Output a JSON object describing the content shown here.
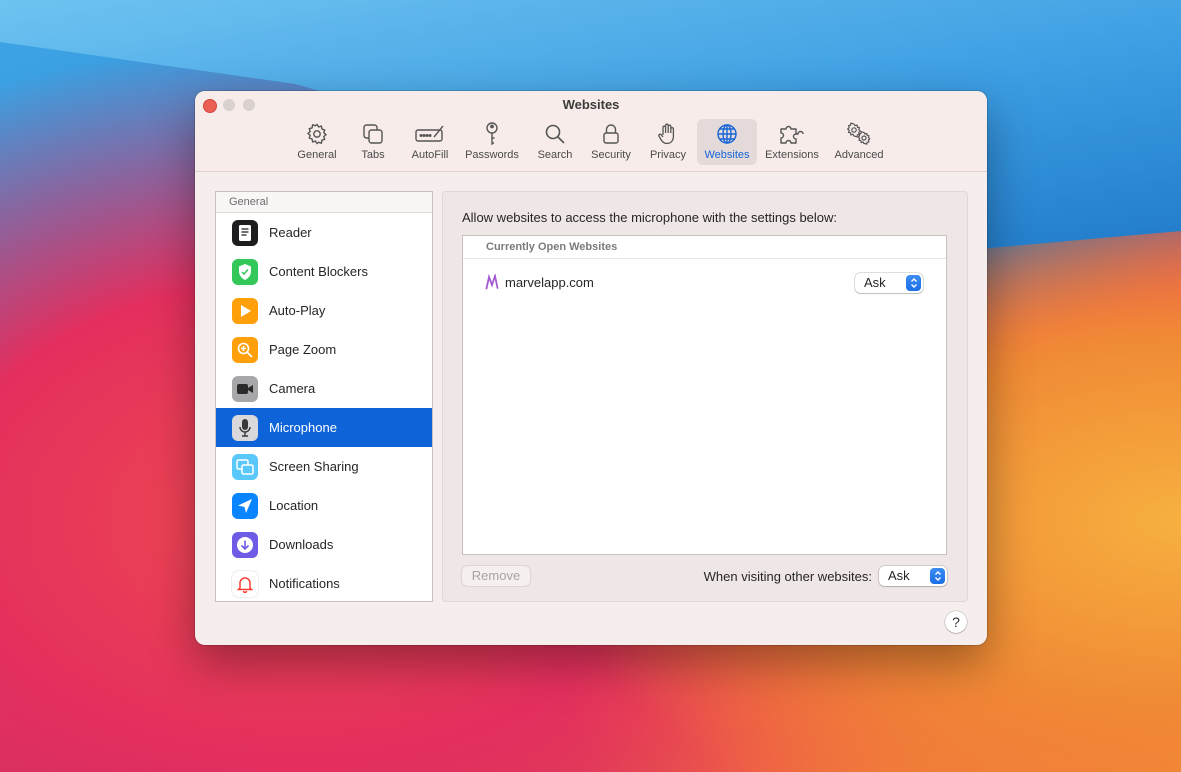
{
  "window": {
    "title": "Websites"
  },
  "toolbar": {
    "items": [
      {
        "label": "General",
        "icon": "gear-icon"
      },
      {
        "label": "Tabs",
        "icon": "tabs-icon"
      },
      {
        "label": "AutoFill",
        "icon": "autofill-icon"
      },
      {
        "label": "Passwords",
        "icon": "key-icon"
      },
      {
        "label": "Search",
        "icon": "magnifier-icon"
      },
      {
        "label": "Security",
        "icon": "lock-icon"
      },
      {
        "label": "Privacy",
        "icon": "hand-icon"
      },
      {
        "label": "Websites",
        "icon": "globe-icon",
        "active": true
      },
      {
        "label": "Extensions",
        "icon": "puzzle-icon"
      },
      {
        "label": "Advanced",
        "icon": "gears-icon"
      }
    ]
  },
  "sidebar": {
    "header": "General",
    "items": [
      {
        "label": "Reader",
        "icon": "reader-icon"
      },
      {
        "label": "Content Blockers",
        "icon": "content-blockers-icon"
      },
      {
        "label": "Auto-Play",
        "icon": "auto-play-icon"
      },
      {
        "label": "Page Zoom",
        "icon": "page-zoom-icon"
      },
      {
        "label": "Camera",
        "icon": "camera-icon"
      },
      {
        "label": "Microphone",
        "icon": "microphone-icon",
        "selected": true
      },
      {
        "label": "Screen Sharing",
        "icon": "screen-sharing-icon"
      },
      {
        "label": "Location",
        "icon": "location-icon"
      },
      {
        "label": "Downloads",
        "icon": "downloads-icon"
      },
      {
        "label": "Notifications",
        "icon": "notifications-icon"
      }
    ]
  },
  "panel": {
    "description": "Allow websites to access the microphone with the settings below:",
    "list_header": "Currently Open Websites",
    "sites": [
      {
        "name": "marvelapp.com",
        "setting": "Ask",
        "icon": "marvel-logo-icon"
      }
    ],
    "remove_label": "Remove",
    "other_label": "When visiting other websites:",
    "other_setting": "Ask"
  },
  "help": {
    "label": "?"
  },
  "colors": {
    "accent": "#0f63d8",
    "active_toolbar_text": "#1765d8",
    "close_button": "#ec5f57"
  }
}
